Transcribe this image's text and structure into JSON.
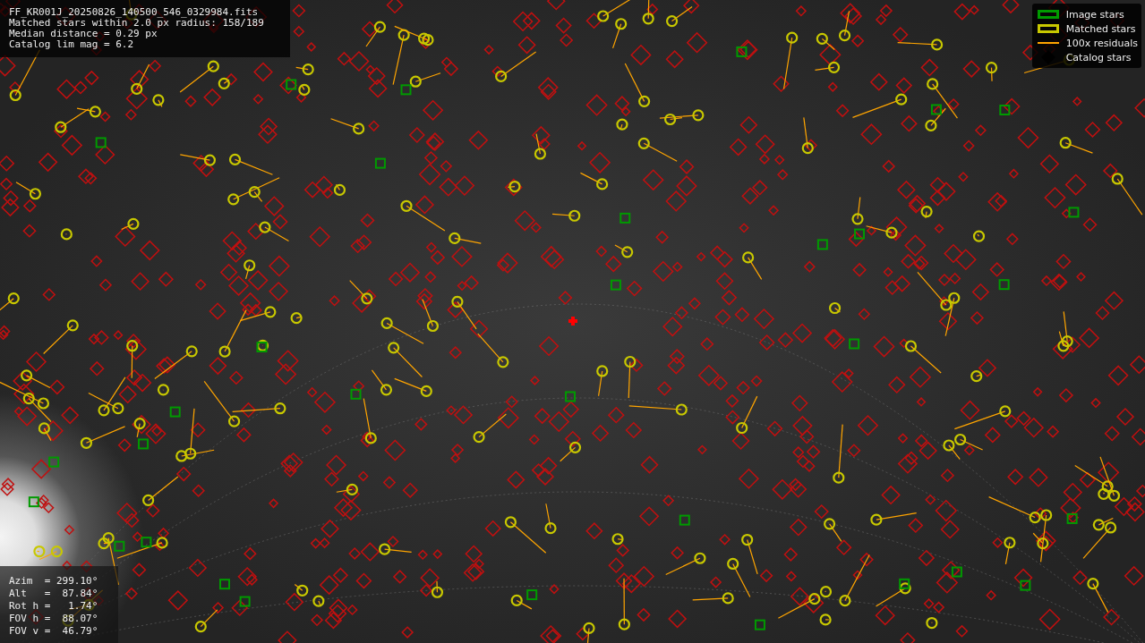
{
  "info_panel": {
    "lines": [
      "FF_KR001J_20250826_140500_546_0329984.fits",
      "Matched stars within 2.0 px radius: 158/189",
      "Median distance = 0.29 px",
      "Catalog lim mag = 6.2"
    ]
  },
  "legend": {
    "items": [
      {
        "kind": "image",
        "label": "Image stars",
        "color": "#009a00"
      },
      {
        "kind": "matched",
        "label": "Matched stars",
        "color": "#c8c800"
      },
      {
        "kind": "residual",
        "label": "100x residuals",
        "color": "#ffa500"
      },
      {
        "kind": "catalog",
        "label": "Catalog stars",
        "color": "#000000"
      }
    ]
  },
  "pointing_panel": {
    "lines": [
      "Azim  = 299.10°",
      "Alt   =  87.84°",
      "Rot h =   1.74°",
      "FOV h =  88.07°",
      "FOV v =  46.79°"
    ]
  }
}
